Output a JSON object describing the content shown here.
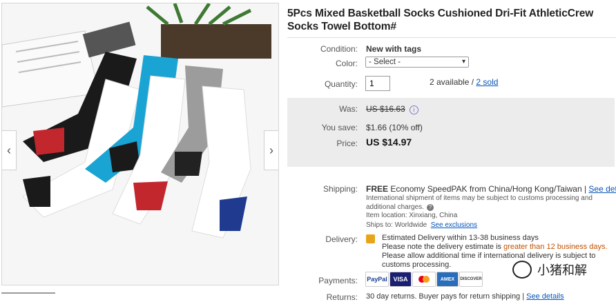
{
  "gallery": {
    "prev_glyph": "‹",
    "next_glyph": "›"
  },
  "product": {
    "title": "5Pcs Mixed Basketball Socks Cushioned Dri-Fit AthleticCrew Socks Towel Bottom#"
  },
  "condition": {
    "label": "Condition:",
    "value": "New with tags"
  },
  "color": {
    "label": "Color:",
    "selected": "- Select -"
  },
  "quantity": {
    "label": "Quantity:",
    "value": "1",
    "available": "2 available / ",
    "sold": "2 sold"
  },
  "pricing": {
    "was_label": "Was:",
    "was_value": "US $16.63",
    "save_label": "You save:",
    "save_value": "$1.66 (10% off)",
    "price_label": "Price:",
    "price_value": "US $14.97"
  },
  "shipping": {
    "label": "Shipping:",
    "free": "FREE",
    "service": "Economy SpeedPAK from China/Hong Kong/Taiwan |",
    "see_details": "See details",
    "note": "International shipment of items may be subject to customs processing and additional charges.",
    "location_label": "Item location:",
    "location_value": "Xinxiang, China",
    "ships_label": "Ships to:",
    "ships_value": "Worldwide",
    "exclusions": "See exclusions"
  },
  "delivery": {
    "label": "Delivery:",
    "estimate": "Estimated Delivery within 13-38 business days",
    "note_a": "Please note the delivery estimate is ",
    "note_b": "greater than 12 business days.",
    "note_c": "Please allow additional time if international delivery is subject to customs processing."
  },
  "payments": {
    "label": "Payments:",
    "methods": [
      "PayPal",
      "VISA",
      "MasterCard",
      "AMEX",
      "DISCOVER"
    ]
  },
  "returns": {
    "label": "Returns:",
    "value": "30 day returns. Buyer pays for return shipping |",
    "see_details": "See details"
  },
  "watermark": {
    "text": "小猪和解"
  },
  "colors": {
    "accent_link": "#0654ba",
    "orange": "#c35100",
    "price_bg": "#ececec"
  }
}
